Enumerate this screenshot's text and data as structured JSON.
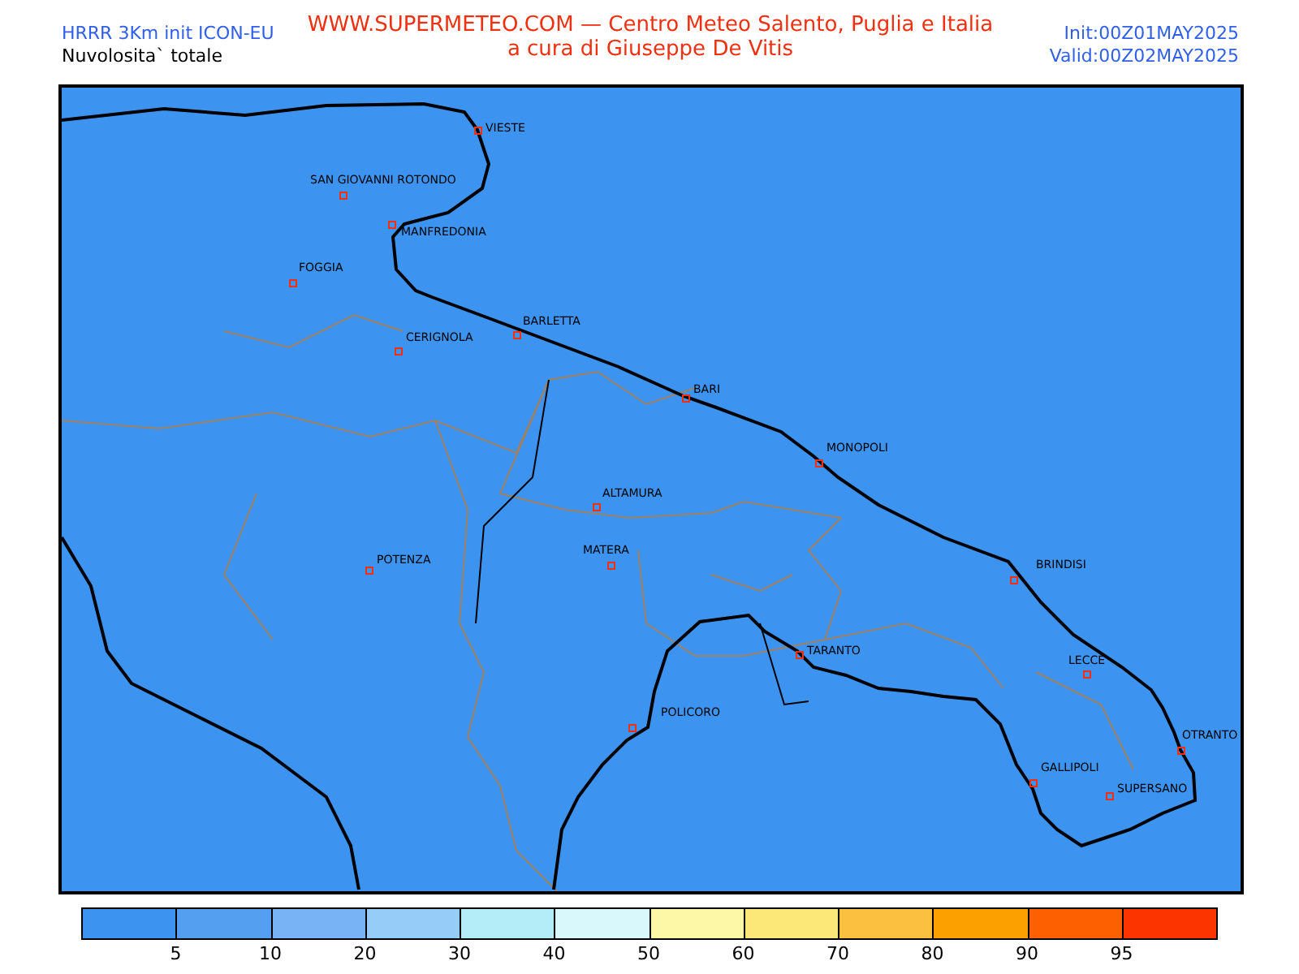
{
  "header": {
    "title": "WWW.SUPERMETEO.COM — Centro Meteo Salento, Puglia e Italia",
    "subtitle": "a cura di Giuseppe De Vitis",
    "model": "HRRR 3Km init ICON-EU",
    "field": "Nuvolosita` totale",
    "init": "Init:00Z01MAY2025",
    "valid": "Valid:00Z02MAY2025"
  },
  "map": {
    "cities": [
      {
        "name": "VIESTE"
      },
      {
        "name": "SAN GIOVANNI ROTONDO"
      },
      {
        "name": "MANFREDONIA"
      },
      {
        "name": "FOGGIA"
      },
      {
        "name": "CERIGNOLA"
      },
      {
        "name": "BARLETTA"
      },
      {
        "name": "BARI"
      },
      {
        "name": "MONOPOLI"
      },
      {
        "name": "ALTAMURA"
      },
      {
        "name": "MATERA"
      },
      {
        "name": "POTENZA"
      },
      {
        "name": "TARANTO"
      },
      {
        "name": "POLICORO"
      },
      {
        "name": "BRINDISI"
      },
      {
        "name": "LECCE"
      },
      {
        "name": "OTRANTO"
      },
      {
        "name": "GALLIPOLI"
      },
      {
        "name": "SUPERSANO"
      }
    ]
  },
  "legend": {
    "bins": [
      {
        "color": "#3c93f0"
      },
      {
        "color": "#559ff0"
      },
      {
        "color": "#78b4f5"
      },
      {
        "color": "#96ccf8"
      },
      {
        "color": "#b4ecf8"
      },
      {
        "color": "#d8f8fc"
      },
      {
        "color": "#fcf8a8"
      },
      {
        "color": "#fce878"
      },
      {
        "color": "#fcc040"
      },
      {
        "color": "#fca000"
      },
      {
        "color": "#fc6000"
      },
      {
        "color": "#fc3400"
      }
    ],
    "labels": [
      "5",
      "10",
      "20",
      "30",
      "40",
      "50",
      "60",
      "70",
      "80",
      "90",
      "95"
    ]
  }
}
